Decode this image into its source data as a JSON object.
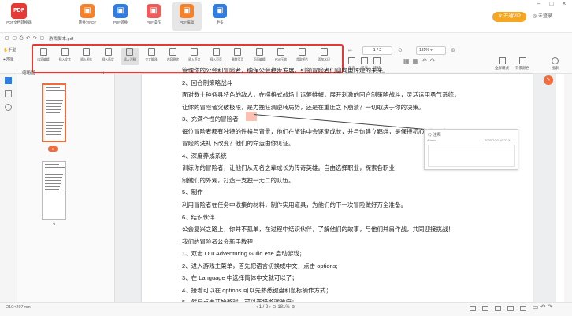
{
  "toolbar_top": {
    "logo_label": "PDF文档转换器",
    "logo_mark": "PDF",
    "buttons": [
      {
        "label": "转换为PDF",
        "color": "#f5812a",
        "icon": "convert-icon"
      },
      {
        "label": "PDF转换",
        "color": "#2f7de1",
        "icon": "pdf-convert-icon"
      },
      {
        "label": "PDF操作",
        "color": "#ef5b5b",
        "icon": "pdf-operate-icon"
      },
      {
        "label": "PDF编辑",
        "color": "#f5812a",
        "icon": "pdf-edit-icon",
        "active": true
      },
      {
        "label": "更多",
        "color": "#2f7de1",
        "icon": "more-grid-icon"
      }
    ],
    "vip_label": "开通VIP",
    "login_label": "未登录",
    "window_controls": [
      "–",
      "□",
      "×"
    ]
  },
  "subbar": {
    "quick_icons": "▢ ▢ ⎙ ↶ ↷ ▢",
    "filename": "游戏脚本.pdf",
    "left_tools": [
      "手型",
      "选择"
    ]
  },
  "edit_tools": [
    "内容编辑",
    "插入文字",
    "插入图片",
    "插入形状",
    "插入注释",
    "全文翻译",
    "内容删除",
    "插入签名",
    "插入页页",
    "删除页页",
    "页面编辑",
    "PDF压缩",
    "提取图片",
    "添加水印"
  ],
  "view_controls": {
    "page_value": "1 / 2",
    "zoom_value": "181%",
    "right_tools": [
      "全屏模式",
      "背景颜色",
      "搜索"
    ],
    "mini_tools": [
      "单页",
      "双页",
      "连续"
    ]
  },
  "thumbnails": {
    "title": "缩略图",
    "close": "×",
    "pages": [
      "1",
      "2"
    ]
  },
  "document": {
    "lines": [
      "管理你的公会和冒险者，确保公会稳步发展，引领冒险者们迎向更辉煌的未来。",
      "2、回合制策略战斗",
      "面对数十种各具特色的敌人，在棋格式战场上运筹帷幄，展开刺激的回合制策略战斗，灵活运用勇气系统，",
      "让你的冒险者突破极限，是力挽狂澜逆转局势，还是在重压之下崩溃？一切取决于你的决策。",
      "3、充满个性的冒险者",
      "每位冒险者都有独特的性格与背景，他们在旅途中会逐渐成长，并与你建立羁绊，是保持初心，还是在",
      "冒险的洗礼下改变？他们的命运由你见证。",
      "4、深度养成系统",
      "训练你的冒险者，让他们从无名之辈成长为传奇英雄。自由选择职业，探索各职业",
      "制他们的外观，打造一支独一无二的队伍。",
      "5、制作",
      "利用冒险者在任务中收集的材料，制作实用道具，为他们的下一次冒险做好万全准备。",
      "6、结识伙伴",
      "公会复兴之路上，你并不孤单，在过程中结识伙伴，了解他们的故事，与他们并肩作战，共同迎接挑战！",
      "我们的冒险者公会新手教程",
      "1、双击 Our Adventuring Guild.exe 启动游戏；",
      "2、进入游戏主菜单，首先把语言切换成中文，点击 options;",
      "3、在 Language 中选择简体中文就可以了；",
      "4、接着可以在 options 可以先熟悉键盘和鼠标操作方式；",
      "5、然后点击开始游戏，可以选择游戏难度；"
    ]
  },
  "comment": {
    "title": "注释",
    "user": "Admin",
    "time": "2025/7/20 10:22:31"
  },
  "statusbar": {
    "page_size": "210×297mm",
    "pager": "‹ 1 / 2 › ⊖ 181% ⊕"
  },
  "colors": {
    "accent": "#e53935",
    "orange": "#f26b3a",
    "vip": "#f5a623"
  }
}
